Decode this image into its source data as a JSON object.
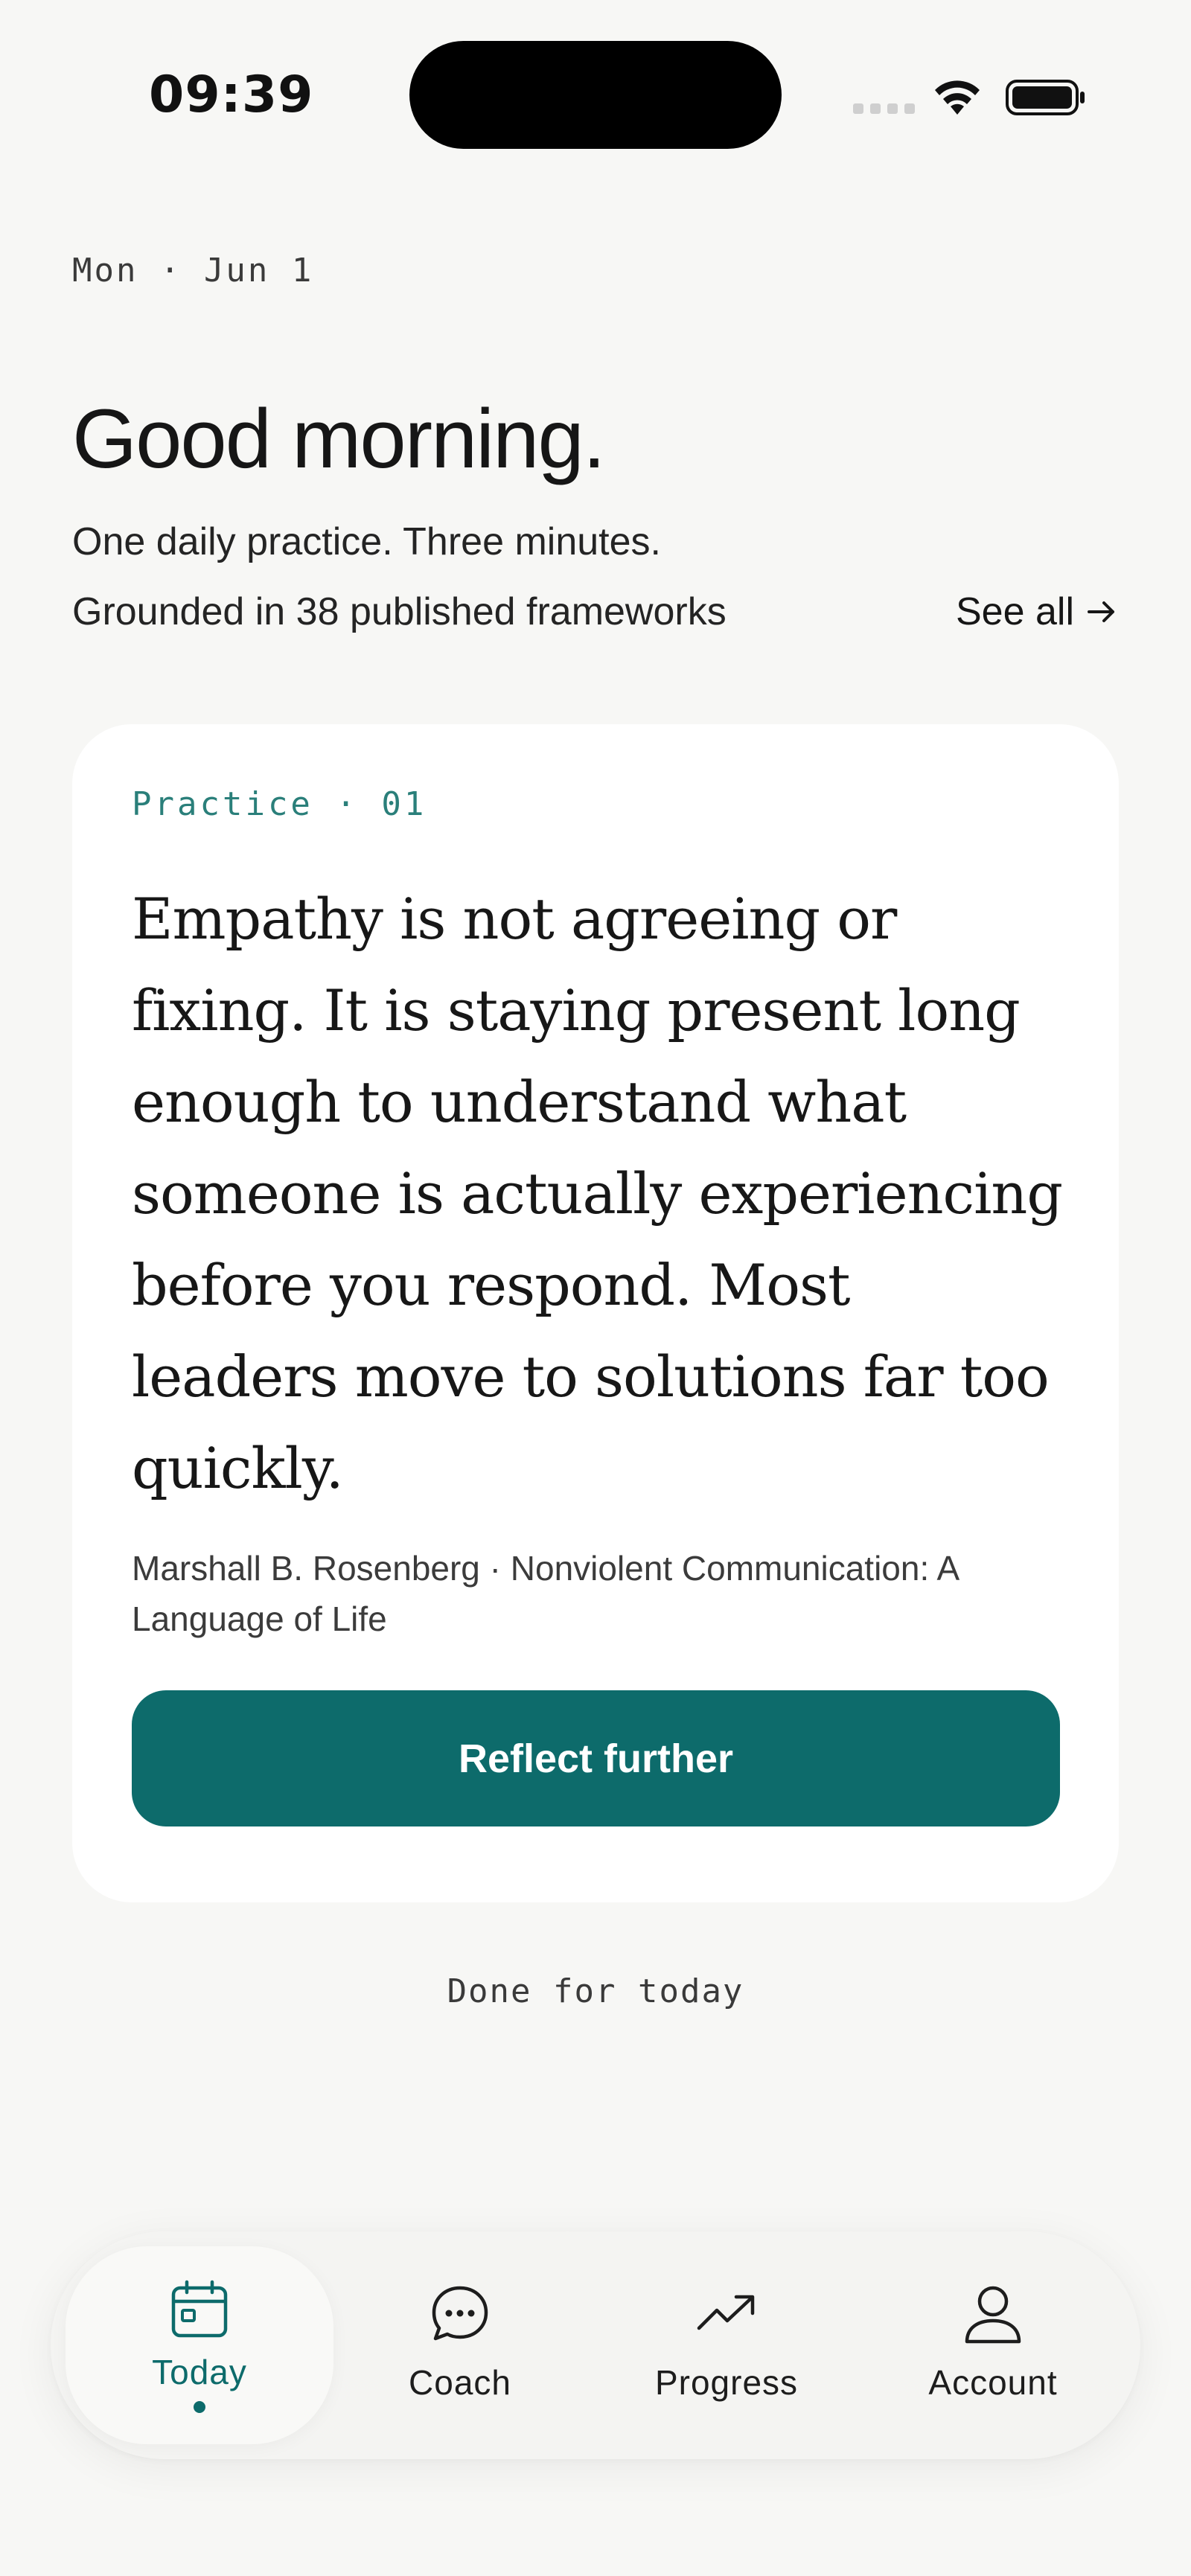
{
  "status_bar": {
    "time": "09:39"
  },
  "header": {
    "date": "Mon · Jun 1",
    "greeting": "Good morning.",
    "subtitle": "One daily practice. Three minutes.",
    "frameworks_text": "Grounded in 38 published frameworks",
    "see_all_label": "See all"
  },
  "card": {
    "tag": "Practice · 01",
    "quote": "Empathy is not agreeing or fixing. It is staying present long enough to understand what someone is actually experiencing before you respond. Most leaders move to solutions far too quickly.",
    "source": "Marshall B. Rosenberg · Nonviolent Communication: A Language of Life",
    "button_label": "Reflect further"
  },
  "done_label": "Done for today",
  "tabbar": {
    "tabs": [
      {
        "label": "Today",
        "icon": "calendar-icon",
        "active": true
      },
      {
        "label": "Coach",
        "icon": "chat-bubble-icon",
        "active": false
      },
      {
        "label": "Progress",
        "icon": "trending-up-icon",
        "active": false
      },
      {
        "label": "Account",
        "icon": "user-icon",
        "active": false
      }
    ]
  },
  "colors": {
    "accent": "#0d6b6b",
    "tag_text": "#2a7f7a",
    "background": "#f7f7f5",
    "card": "#ffffff"
  }
}
